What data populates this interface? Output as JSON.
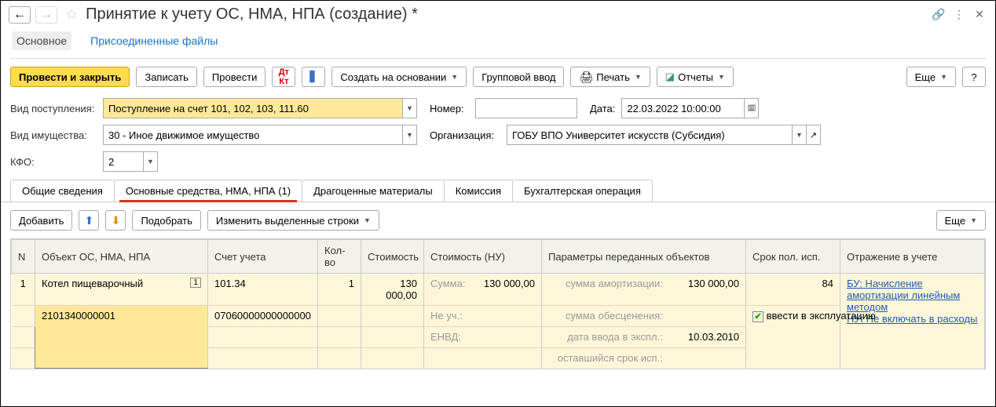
{
  "header": {
    "title": "Принятие к учету ОС, НМА, НПА (создание) *"
  },
  "section_nav": {
    "main": "Основное",
    "attachments": "Присоединенные файлы"
  },
  "toolbar": {
    "submit_close": "Провести и закрыть",
    "save": "Записать",
    "submit": "Провести",
    "create_based": "Создать на основании",
    "group_input": "Групповой ввод",
    "print": "Печать",
    "reports": "Отчеты",
    "more": "Еще",
    "help": "?"
  },
  "fields": {
    "receipt_type_label": "Вид поступления:",
    "receipt_type_value": "Поступление на счет 101, 102, 103, 111.60",
    "number_label": "Номер:",
    "number_value": "",
    "date_label": "Дата:",
    "date_value": "22.03.2022 10:00:00",
    "property_type_label": "Вид имущества:",
    "property_type_value": "30 - Иное движимое имущество",
    "org_label": "Организация:",
    "org_value": "ГОБУ ВПО Университет искусств (Субсидия)",
    "kfo_label": "КФО:",
    "kfo_value": "2"
  },
  "tabs": {
    "general": "Общие сведения",
    "assets": "Основные средства, НМА, НПА (1)",
    "precious": "Драгоценные материалы",
    "commission": "Комиссия",
    "accounting": "Бухгалтерская операция"
  },
  "subtoolbar": {
    "add": "Добавить",
    "select": "Подобрать",
    "edit_rows": "Изменить выделенные строки",
    "more": "Еще"
  },
  "table": {
    "headers": {
      "n": "N",
      "object": "Объект ОС, НМА, НПА",
      "account": "Счет учета",
      "qty": "Кол-во",
      "cost": "Стоимость",
      "cost_nu": "Стоимость (НУ)",
      "params": "Параметры переданных объектов",
      "life": "Срок пол. исп.",
      "reflection": "Отражение в учете"
    },
    "row": {
      "n": "1",
      "object_name": "Котел пищеварочный",
      "object_badge": "1",
      "inv_number": "2101340000001",
      "account1": "101.34",
      "account2": "07060000000000000",
      "qty": "1",
      "cost": "130 000,00",
      "nu_sum_label": "Сумма:",
      "nu_sum_val": "130 000,00",
      "nu_excl_label": "Не уч.:",
      "nu_envd_label": "ЕНВД:",
      "param_amort_label": "сумма амортизации:",
      "param_amort_val": "130 000,00",
      "param_impair_label": "сумма обесценения:",
      "param_date_label": "дата ввода в экспл.:",
      "param_date_val": "10.03.2010",
      "param_remain_label": "оставшийся срок исп.:",
      "life": "84",
      "commission_check_label": "ввести в эксплуатацию",
      "reflection_bu": "БУ: Начисление амортизации линейным методом",
      "reflection_nu": "НУ: Не включать в расходы"
    }
  }
}
